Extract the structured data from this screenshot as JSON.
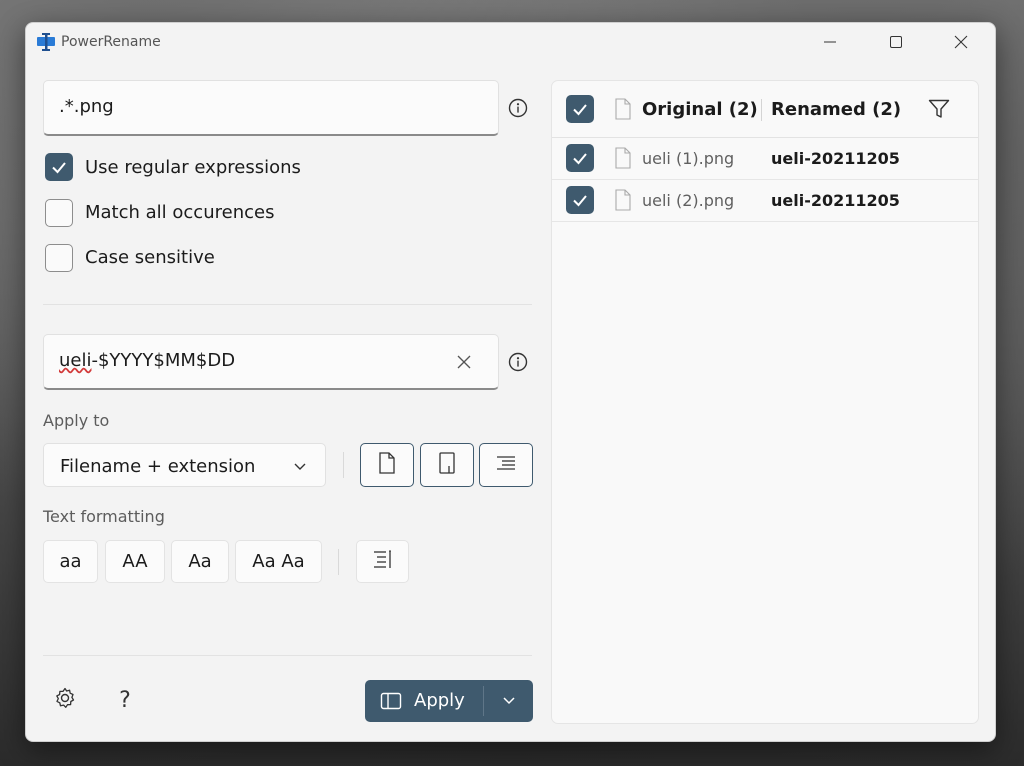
{
  "window": {
    "title": "PowerRename"
  },
  "search": {
    "value": ".*.png"
  },
  "options": [
    {
      "label": "Use regular expressions",
      "checked": true
    },
    {
      "label": "Match all occurences",
      "checked": false
    },
    {
      "label": "Case sensitive",
      "checked": false
    }
  ],
  "replace": {
    "value_prefix": "ueli",
    "value_rest": "-$YYYY$MM$DD"
  },
  "apply_to": {
    "label": "Apply to",
    "selected": "Filename + extension"
  },
  "text_formatting": {
    "label": "Text formatting",
    "buttons": [
      "aa",
      "AA",
      "Aa",
      "Aa Aa"
    ]
  },
  "apply_button": {
    "label": "Apply"
  },
  "list": {
    "original_header": "Original (2)",
    "renamed_header": "Renamed (2)",
    "rows": [
      {
        "original": "ueli (1).png",
        "renamed": "ueli-20211205",
        "checked": true
      },
      {
        "original": "ueli (2).png",
        "renamed": "ueli-20211205",
        "checked": true
      }
    ]
  },
  "colors": {
    "accent": "#3f5a6e",
    "window_bg": "#f3f3f3"
  }
}
